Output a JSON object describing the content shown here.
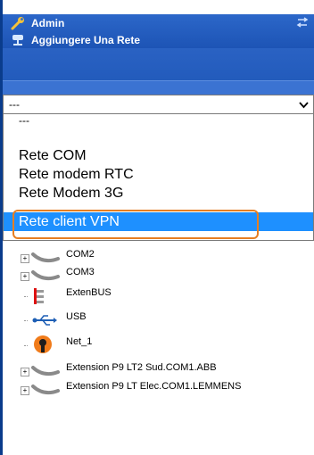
{
  "header": {
    "title": "Admin",
    "subtitle": "Aggiungere Una Rete"
  },
  "network_select": {
    "value": "---",
    "options": [
      "---",
      "Rete COM",
      "Rete modem RTC",
      "Rete Modem 3G",
      "Rete client VPN"
    ],
    "selected_index": 4
  },
  "tree": {
    "items": [
      {
        "label": "COM2",
        "icon": "serial-cable-icon"
      },
      {
        "label": "COM3",
        "icon": "serial-cable-icon"
      },
      {
        "label": "ExtenBUS",
        "icon": "extenbus-icon"
      },
      {
        "label": "USB",
        "icon": "usb-icon"
      },
      {
        "label": "Net_1",
        "icon": "network-node-icon"
      },
      {
        "label": "Extension P9 LT2 Sud.COM1.ABB",
        "icon": "serial-cable-icon"
      },
      {
        "label": "Extension P9 LT Elec.COM1.LEMMENS",
        "icon": "serial-cable-icon"
      }
    ]
  },
  "colors": {
    "header_blue": "#1d54b5",
    "selection_blue": "#1e90ff",
    "highlight_orange": "#e67e22"
  }
}
